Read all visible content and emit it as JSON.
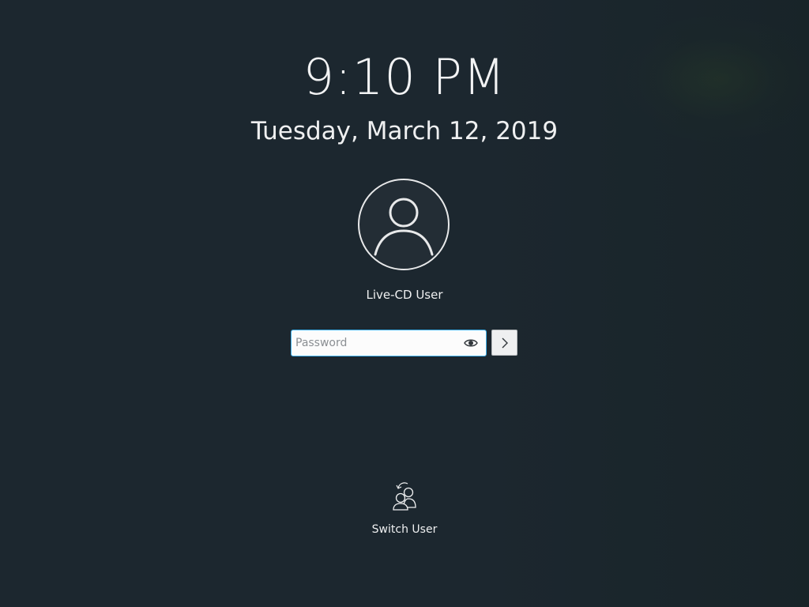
{
  "clock": {
    "time": "9:10 PM",
    "date": "Tuesday, March 12, 2019"
  },
  "user": {
    "name": "Live-CD User",
    "avatar_icon": "user-avatar-icon"
  },
  "password": {
    "placeholder": "Password",
    "value": "",
    "reveal_icon": "eye-icon"
  },
  "login": {
    "icon": "chevron-right-icon"
  },
  "actions": {
    "switch_user_label": "Switch User",
    "switch_user_icon": "switch-user-icon"
  },
  "colors": {
    "background": "#1c272f",
    "accent": "#3daee9",
    "text": "#eff0f1"
  }
}
